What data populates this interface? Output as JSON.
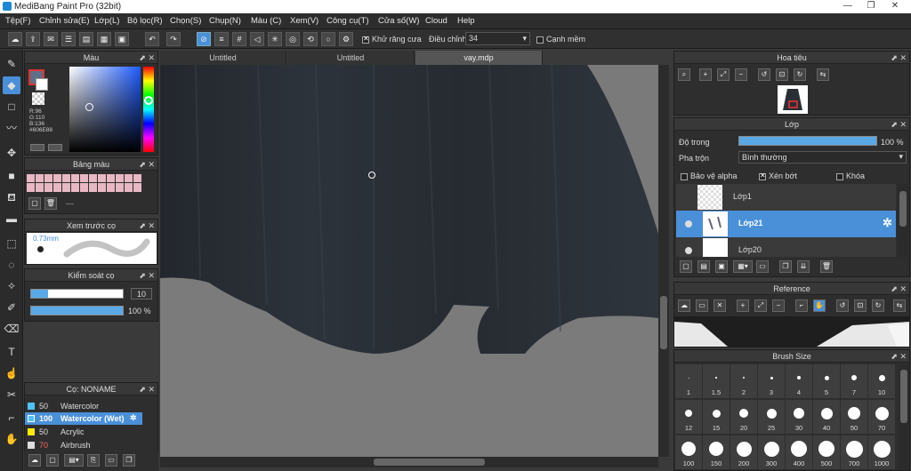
{
  "app": {
    "title": "MediBang Paint Pro (32bit)"
  },
  "menu": [
    "Tệp(F)",
    "Chỉnh sửa(E)",
    "Lớp(L)",
    "Bộ lọc(R)",
    "Chọn(S)",
    "Chụp(N)",
    "Màu (C)",
    "Xem(V)",
    "Công cụ(T)",
    "Cửa số(W)",
    "Cloud",
    "Help"
  ],
  "toolbar": {
    "antialias_label": "Khử răng cưa",
    "adjust_label": "Điều chỉnh",
    "adjust_value": "34",
    "soft_edge_label": "Cạnh mềm"
  },
  "tabs": [
    "Untitled",
    "Untitled",
    "vay.mdp"
  ],
  "color_panel": {
    "title": "Màu",
    "r": "R:96",
    "g": "G:110",
    "b": "B:136",
    "hex": "#606E88",
    "fg_color": "#606e88"
  },
  "palette_panel": {
    "title": "Bảng màu",
    "extra": "---"
  },
  "brush_preview_panel": {
    "title": "Xem trước cọ",
    "size_label": "0.73mm"
  },
  "brush_control_panel": {
    "title": "Kiểm soát cọ",
    "size_value": "10",
    "opacity_value": "100 %"
  },
  "brush_panel": {
    "title": "Cọ: NONAME",
    "items": [
      {
        "size": "50",
        "name": "Watercolor",
        "color": "#4fc3f7"
      },
      {
        "size": "100",
        "name": "Watercolor (Wet)",
        "color": "#4fc3f7"
      },
      {
        "size": "50",
        "name": "Acrylic",
        "color": "#ffee00"
      },
      {
        "size": "70",
        "name": "Airbrush",
        "color": "#dddddd"
      }
    ]
  },
  "navigator_panel": {
    "title": "Hoa tiêu"
  },
  "layer_panel": {
    "title": "Lớp",
    "opacity_label": "Độ trong",
    "opacity_value": "100 %",
    "blend_label": "Pha trộn",
    "blend_value": "Bình thường",
    "protect_alpha": "Bảo vệ alpha",
    "clipping": "Xén bớt",
    "lock": "Khóa",
    "layers": [
      {
        "name": "Lớp1"
      },
      {
        "name": "Lớp21"
      },
      {
        "name": "Lớp20"
      }
    ]
  },
  "reference_panel": {
    "title": "Reference"
  },
  "brush_size_panel": {
    "title": "Brush Size",
    "sizes": [
      "1",
      "1.5",
      "2",
      "3",
      "4",
      "5",
      "7",
      "10",
      "12",
      "15",
      "20",
      "25",
      "30",
      "40",
      "50",
      "70",
      "100",
      "150",
      "200",
      "300",
      "400",
      "500",
      "700",
      "1000"
    ]
  }
}
